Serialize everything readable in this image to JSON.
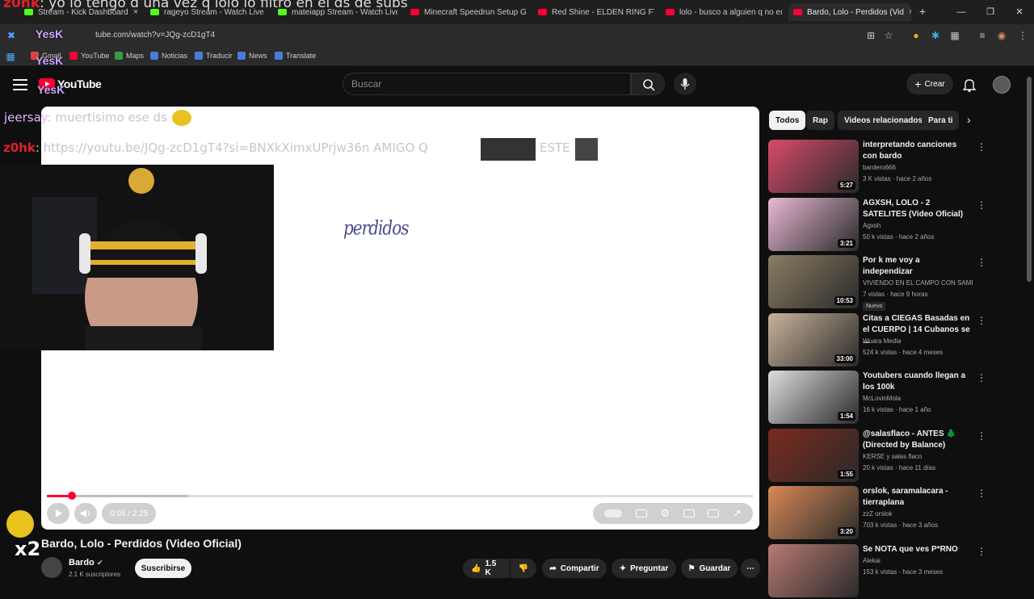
{
  "browser": {
    "tabs": [
      {
        "label": "Stream - Kick Dashboard"
      },
      {
        "label": "rageyo Stream - Watch Live o"
      },
      {
        "label": "mateiapp Stream - Watch Live"
      },
      {
        "label": "Minecraft Speedrun Setup Guid"
      },
      {
        "label": "Red Shine - ELDEN RING FT ma"
      },
      {
        "label": "lolo - busco a alguien q no enc"
      },
      {
        "label": "Bardo, Lolo - Perdidos (Vid"
      }
    ],
    "new_tab": "+",
    "url": "tube.com/watch?v=JQg-zcD1gT4",
    "bookmarks": [
      "Gmail",
      "YouTube",
      "Maps",
      "Noticias",
      "Traducir",
      "News",
      "Translate"
    ]
  },
  "overlay": {
    "top_user": "z0hk",
    "top_message": ": yo lo tengo d una vez q lolo lo filtro en el ds de subs",
    "emote_tag": "YesK",
    "chat1_user": "jeersay",
    "chat1_message": ": muertisimo ese ds",
    "chat2_user": "z0hk",
    "chat2_message": ": https://youtu.be/JQg-zcD1gT4?si=BNXkXimxUPrjw36n AMIGO Q",
    "chat2_tail": "ESTE",
    "multiplier": "x2"
  },
  "youtube": {
    "logo_text": "YouTube",
    "search_placeholder": "Buscar",
    "create_label": "Crear",
    "video_art_text": "perdidos",
    "player": {
      "time": "0:05 / 2:25",
      "progress": 0.035,
      "buffered": 0.2
    },
    "video_title": "Bardo, Lolo - Perdidos (Video Oficial)",
    "channel": "Bardo",
    "subscribers": "2.1 K suscriptores",
    "subscribe_label": "Suscribirse",
    "likes": "1.5 K",
    "share_label": "Compartir",
    "ask_label": "Preguntar",
    "save_label": "Guardar",
    "chips": [
      "Todos",
      "Rap",
      "Videos relacionados",
      "Para ti"
    ],
    "recommendations": [
      {
        "title": "interpretando canciones con bardo",
        "channel": "bardero666",
        "meta": "3 K vistas · hace 2 años",
        "duration": "5:27",
        "color": "#d94b6a"
      },
      {
        "title": "AGXSH, LOLO - 2 SATELITES (Video Oficial)",
        "channel": "Agxsh",
        "meta": "50 k vistas · hace 2 años",
        "duration": "3:21",
        "color": "#e8b9d4"
      },
      {
        "title": "Por k me voy a independizar",
        "channel": "VIVIENDO EN EL CAMPO CON SAMI",
        "meta": "7 vistas · hace 9 horas",
        "badge": "Nuevo",
        "duration": "10:53",
        "color": "#8a7d63"
      },
      {
        "title": "Citas a CIEGAS Basadas en el CUERPO | 14 Cubanos se ...",
        "channel": "Wuara Media",
        "meta": "524 k vistas · hace 4 meses",
        "duration": "33:00",
        "color": "#c9b39a"
      },
      {
        "title": "Youtubers cuando llegan a los 100k",
        "channel": "McLovinMola",
        "meta": "16 k vistas · hace 1 año",
        "duration": "1:54",
        "color": "#dedede"
      },
      {
        "title": "@salasflaco - ANTES 🌲 (Directed by Balance)",
        "channel": "KERSE y salas flaco",
        "meta": "20 k vistas · hace 11 días",
        "duration": "1:55",
        "color": "#7a2b1f"
      },
      {
        "title": "orslok, saramalacara - tierraplana",
        "channel": "zzZ orslok",
        "meta": "703 k vistas · hace 3 años",
        "duration": "3:20",
        "color": "#d88a57"
      },
      {
        "title": "Se NOTA que ves P*RNO",
        "channel": "Alekai",
        "meta": "153 k vistas · hace 3 meses",
        "duration": "",
        "color": "#b97a73"
      }
    ]
  }
}
